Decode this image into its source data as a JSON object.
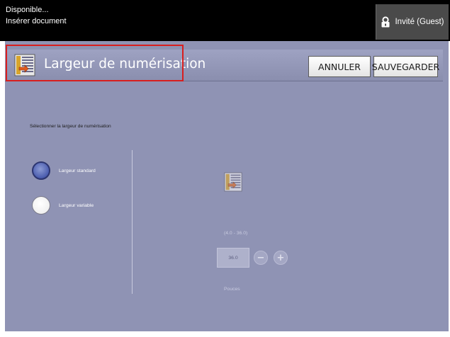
{
  "status": {
    "line1": "Disponible...",
    "line2": "Insérer document"
  },
  "user": {
    "label": "Invité (Guest)",
    "icon": "user-lock-icon"
  },
  "header": {
    "title": "Largeur de numérisation",
    "icon": "scan-document-icon",
    "cancel_label": "ANNULER",
    "save_label": "SAUVEGARDER",
    "highlight_color": "#d81e1e"
  },
  "main": {
    "instruction": "Sélectionner la largeur de numérisation",
    "options": [
      {
        "label": "Largeur standard",
        "selected": true
      },
      {
        "label": "Largeur variable",
        "selected": false
      }
    ],
    "width_input": {
      "range": "(4.0 - 36.0)",
      "value": "36.0",
      "unit": "Pouces",
      "minus_label": "−",
      "plus_label": "+"
    }
  },
  "colors": {
    "panel": "#8f93b4",
    "statusbar": "#000000",
    "selected_radio": "#4a5cae"
  }
}
